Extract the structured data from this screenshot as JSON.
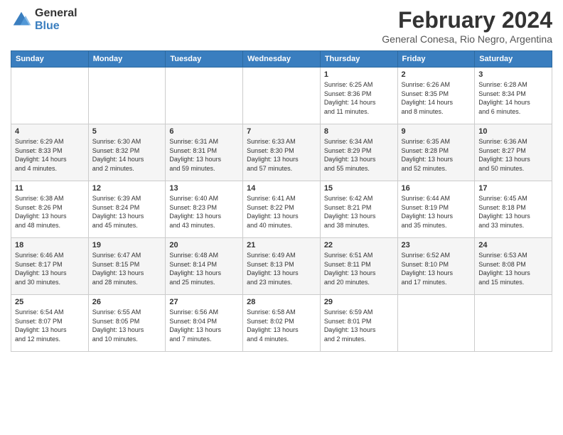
{
  "logo": {
    "general": "General",
    "blue": "Blue"
  },
  "header": {
    "month": "February 2024",
    "location": "General Conesa, Rio Negro, Argentina"
  },
  "weekdays": [
    "Sunday",
    "Monday",
    "Tuesday",
    "Wednesday",
    "Thursday",
    "Friday",
    "Saturday"
  ],
  "weeks": [
    [
      {
        "day": "",
        "info": ""
      },
      {
        "day": "",
        "info": ""
      },
      {
        "day": "",
        "info": ""
      },
      {
        "day": "",
        "info": ""
      },
      {
        "day": "1",
        "info": "Sunrise: 6:25 AM\nSunset: 8:36 PM\nDaylight: 14 hours\nand 11 minutes."
      },
      {
        "day": "2",
        "info": "Sunrise: 6:26 AM\nSunset: 8:35 PM\nDaylight: 14 hours\nand 8 minutes."
      },
      {
        "day": "3",
        "info": "Sunrise: 6:28 AM\nSunset: 8:34 PM\nDaylight: 14 hours\nand 6 minutes."
      }
    ],
    [
      {
        "day": "4",
        "info": "Sunrise: 6:29 AM\nSunset: 8:33 PM\nDaylight: 14 hours\nand 4 minutes."
      },
      {
        "day": "5",
        "info": "Sunrise: 6:30 AM\nSunset: 8:32 PM\nDaylight: 14 hours\nand 2 minutes."
      },
      {
        "day": "6",
        "info": "Sunrise: 6:31 AM\nSunset: 8:31 PM\nDaylight: 13 hours\nand 59 minutes."
      },
      {
        "day": "7",
        "info": "Sunrise: 6:33 AM\nSunset: 8:30 PM\nDaylight: 13 hours\nand 57 minutes."
      },
      {
        "day": "8",
        "info": "Sunrise: 6:34 AM\nSunset: 8:29 PM\nDaylight: 13 hours\nand 55 minutes."
      },
      {
        "day": "9",
        "info": "Sunrise: 6:35 AM\nSunset: 8:28 PM\nDaylight: 13 hours\nand 52 minutes."
      },
      {
        "day": "10",
        "info": "Sunrise: 6:36 AM\nSunset: 8:27 PM\nDaylight: 13 hours\nand 50 minutes."
      }
    ],
    [
      {
        "day": "11",
        "info": "Sunrise: 6:38 AM\nSunset: 8:26 PM\nDaylight: 13 hours\nand 48 minutes."
      },
      {
        "day": "12",
        "info": "Sunrise: 6:39 AM\nSunset: 8:24 PM\nDaylight: 13 hours\nand 45 minutes."
      },
      {
        "day": "13",
        "info": "Sunrise: 6:40 AM\nSunset: 8:23 PM\nDaylight: 13 hours\nand 43 minutes."
      },
      {
        "day": "14",
        "info": "Sunrise: 6:41 AM\nSunset: 8:22 PM\nDaylight: 13 hours\nand 40 minutes."
      },
      {
        "day": "15",
        "info": "Sunrise: 6:42 AM\nSunset: 8:21 PM\nDaylight: 13 hours\nand 38 minutes."
      },
      {
        "day": "16",
        "info": "Sunrise: 6:44 AM\nSunset: 8:19 PM\nDaylight: 13 hours\nand 35 minutes."
      },
      {
        "day": "17",
        "info": "Sunrise: 6:45 AM\nSunset: 8:18 PM\nDaylight: 13 hours\nand 33 minutes."
      }
    ],
    [
      {
        "day": "18",
        "info": "Sunrise: 6:46 AM\nSunset: 8:17 PM\nDaylight: 13 hours\nand 30 minutes."
      },
      {
        "day": "19",
        "info": "Sunrise: 6:47 AM\nSunset: 8:15 PM\nDaylight: 13 hours\nand 28 minutes."
      },
      {
        "day": "20",
        "info": "Sunrise: 6:48 AM\nSunset: 8:14 PM\nDaylight: 13 hours\nand 25 minutes."
      },
      {
        "day": "21",
        "info": "Sunrise: 6:49 AM\nSunset: 8:13 PM\nDaylight: 13 hours\nand 23 minutes."
      },
      {
        "day": "22",
        "info": "Sunrise: 6:51 AM\nSunset: 8:11 PM\nDaylight: 13 hours\nand 20 minutes."
      },
      {
        "day": "23",
        "info": "Sunrise: 6:52 AM\nSunset: 8:10 PM\nDaylight: 13 hours\nand 17 minutes."
      },
      {
        "day": "24",
        "info": "Sunrise: 6:53 AM\nSunset: 8:08 PM\nDaylight: 13 hours\nand 15 minutes."
      }
    ],
    [
      {
        "day": "25",
        "info": "Sunrise: 6:54 AM\nSunset: 8:07 PM\nDaylight: 13 hours\nand 12 minutes."
      },
      {
        "day": "26",
        "info": "Sunrise: 6:55 AM\nSunset: 8:05 PM\nDaylight: 13 hours\nand 10 minutes."
      },
      {
        "day": "27",
        "info": "Sunrise: 6:56 AM\nSunset: 8:04 PM\nDaylight: 13 hours\nand 7 minutes."
      },
      {
        "day": "28",
        "info": "Sunrise: 6:58 AM\nSunset: 8:02 PM\nDaylight: 13 hours\nand 4 minutes."
      },
      {
        "day": "29",
        "info": "Sunrise: 6:59 AM\nSunset: 8:01 PM\nDaylight: 13 hours\nand 2 minutes."
      },
      {
        "day": "",
        "info": ""
      },
      {
        "day": "",
        "info": ""
      }
    ]
  ]
}
